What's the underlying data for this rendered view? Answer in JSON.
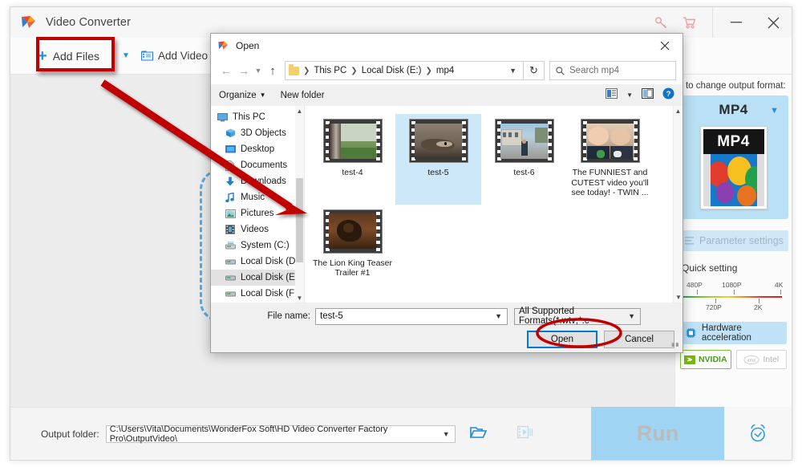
{
  "app": {
    "title": "Video Converter",
    "logo_icon": "wonderfox-logo-icon",
    "titlebar_icons": [
      {
        "name": "key-icon",
        "label": ""
      },
      {
        "name": "cart-icon",
        "label": ""
      }
    ],
    "window_controls": [
      {
        "name": "minimize-button",
        "glyph": "—"
      },
      {
        "name": "close-button",
        "glyph": "✕"
      }
    ],
    "toolbar": {
      "add_files_label": "Add Files",
      "add_files_icon": "plus-icon",
      "dropdown_icon": "chevron-down-icon",
      "add_video_label": "Add Video",
      "add_video_icon": "film-folder-icon"
    },
    "right_panel": {
      "change_format_hint": "k to change output format:",
      "format_name": "MP4",
      "format_caret_icon": "chevron-down-icon",
      "format_thumb_label": "MP4",
      "parameter_settings_label": "Parameter settings",
      "parameter_settings_icon": "sliders-icon",
      "quick_setting_label": "Quick setting",
      "quick_setting_ticks_top": [
        "480P",
        "1080P",
        "4K"
      ],
      "quick_setting_ticks_bottom": [
        "720P",
        "2K"
      ],
      "hardware_accel_label": "Hardware acceleration",
      "hardware_accel_icon": "chip-icon",
      "gpu_chips": [
        {
          "label": "NVIDIA",
          "enabled": true,
          "icon": "nvidia-icon"
        },
        {
          "label": "Intel",
          "enabled": false,
          "icon": "intel-icon"
        }
      ]
    },
    "footer": {
      "output_folder_label": "Output folder:",
      "output_folder_path": "C:\\Users\\Vita\\Documents\\WonderFox Soft\\HD Video Converter Factory Pro\\OutputVideo\\",
      "dropdown_icon": "chevron-down-icon",
      "open_folder_icon": "folder-open-icon",
      "merge_icon": "merge-video-icon",
      "run_label": "Run",
      "alarm_icon": "alarm-clock-icon"
    }
  },
  "dialog": {
    "title": "Open",
    "logo_icon": "wonderfox-logo-icon",
    "close_icon": "close-icon",
    "nav": {
      "back_icon": "arrow-left-icon",
      "forward_icon": "arrow-right-icon",
      "recent_icon": "chevron-down-icon",
      "up_icon": "arrow-up-icon",
      "breadcrumb_icon": "folder-icon",
      "breadcrumb": [
        "This PC",
        "Local Disk (E:)",
        "mp4"
      ],
      "breadcrumb_caret_icon": "chevron-down-icon",
      "refresh_icon": "refresh-icon",
      "search_icon": "search-icon",
      "search_placeholder": "Search mp4"
    },
    "commandbar": {
      "organize_label": "Organize",
      "organize_caret_icon": "chevron-down-icon",
      "new_folder_label": "New folder",
      "view_icon": "view-layout-icon",
      "view_caret_icon": "chevron-down-icon",
      "preview_pane_icon": "preview-pane-icon",
      "help_icon": "help-icon"
    },
    "tree": {
      "scroll_up_icon": "chevron-up-icon",
      "scroll_down_icon": "chevron-down-icon",
      "items": [
        {
          "label": "This PC",
          "icon": "monitor-icon",
          "level": 0,
          "selected": false
        },
        {
          "label": "3D Objects",
          "icon": "cube-icon",
          "level": 1,
          "selected": false
        },
        {
          "label": "Desktop",
          "icon": "desktop-icon",
          "level": 1,
          "selected": false
        },
        {
          "label": "Documents",
          "icon": "document-icon",
          "level": 1,
          "selected": false
        },
        {
          "label": "Downloads",
          "icon": "download-icon",
          "level": 1,
          "selected": false
        },
        {
          "label": "Music",
          "icon": "music-icon",
          "level": 1,
          "selected": false
        },
        {
          "label": "Pictures",
          "icon": "pictures-icon",
          "level": 1,
          "selected": false
        },
        {
          "label": "Videos",
          "icon": "videos-icon",
          "level": 1,
          "selected": false
        },
        {
          "label": "System (C:)",
          "icon": "system-drive-icon",
          "level": 1,
          "selected": false
        },
        {
          "label": "Local Disk (D:)",
          "icon": "drive-icon",
          "level": 1,
          "selected": false
        },
        {
          "label": "Local Disk (E:)",
          "icon": "drive-icon",
          "level": 1,
          "selected": true
        },
        {
          "label": "Local Disk (F:)",
          "icon": "drive-icon",
          "level": 1,
          "selected": false
        }
      ]
    },
    "files": {
      "scroll_up_icon": "chevron-up-icon",
      "scroll_down_icon": "chevron-down-icon",
      "items": [
        {
          "name": "test-4",
          "selected": false,
          "thumb": "garden"
        },
        {
          "name": "test-5",
          "selected": true,
          "thumb": "snake"
        },
        {
          "name": "test-6",
          "selected": false,
          "thumb": "station"
        },
        {
          "name": "The FUNNIEST and CUTEST video you'll see today! - TWIN ...",
          "selected": false,
          "thumb": "twins"
        },
        {
          "name": "The Lion King Teaser Trailer #1",
          "selected": false,
          "thumb": "lionking"
        }
      ]
    },
    "bottom": {
      "file_name_label": "File name:",
      "file_name_value": "test-5",
      "file_name_caret_icon": "chevron-down-icon",
      "filter_value": "All Supported Formats(*.wtv;*.c",
      "filter_caret_icon": "chevron-down-icon",
      "open_label": "Open",
      "cancel_label": "Cancel",
      "resize_grip_icon": "resize-grip-icon"
    }
  },
  "annotations": {
    "highlight_color": "#c00000",
    "box_target": "add-files-button",
    "arrow_from": "add-files-button",
    "arrow_to": "file-list",
    "ellipse_target": "open-button"
  }
}
